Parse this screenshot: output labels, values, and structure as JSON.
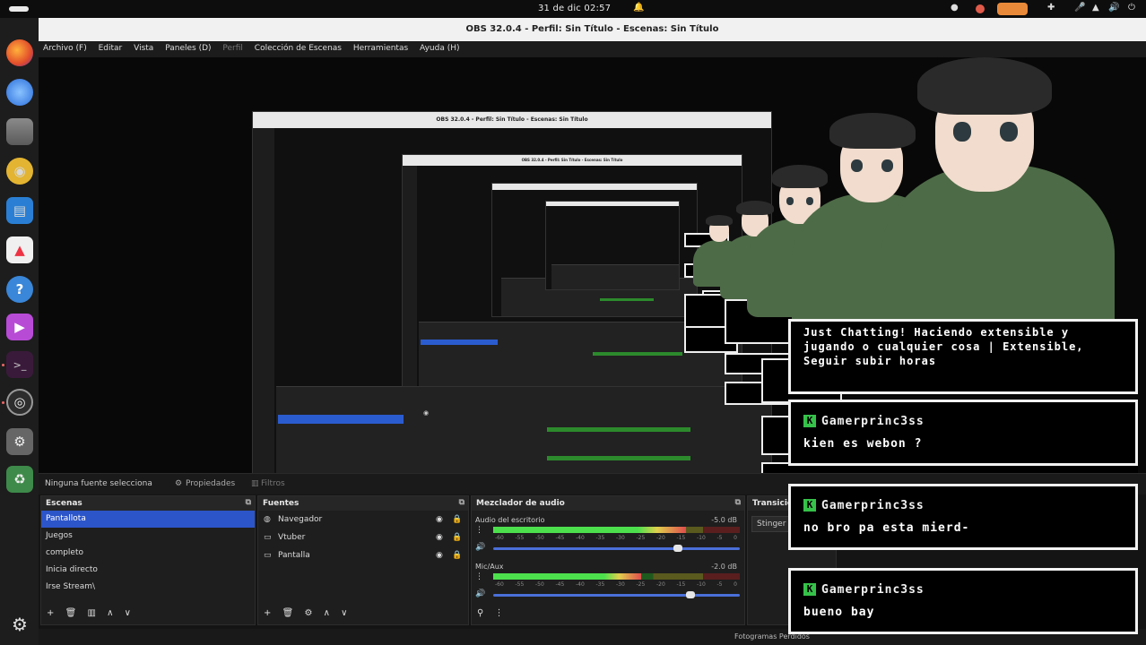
{
  "topbar": {
    "clock": "31 de dic  02:57",
    "bell_icon": "bell-icon",
    "tray_icons": [
      "record-indicator-icon",
      "screen-share-icon",
      "extensions-icon",
      "mic-icon",
      "wifi-icon",
      "volume-icon",
      "power-icon"
    ]
  },
  "dock": {
    "apps": [
      "firefox-icon",
      "thunderbird-icon",
      "files-icon",
      "rhythmbox-icon",
      "writer-icon",
      "app-center-icon",
      "help-icon",
      "video-icon",
      "terminal-icon",
      "obs-icon",
      "settings-icon",
      "trash-icon",
      "show-apps-icon"
    ]
  },
  "obs": {
    "title": "OBS 32.0.4 - Perfil: Sin Título - Escenas: Sin Título",
    "menu": [
      "Archivo (F)",
      "Editar",
      "Vista",
      "Paneles (D)",
      "Perfil",
      "Colección de Escenas",
      "Herramientas",
      "Ayuda (H)"
    ],
    "source_bar": {
      "selected_source": "Ninguna fuente selecciona",
      "properties": "Propiedades",
      "filters": "Filtros"
    },
    "scenes": {
      "title": "Escenas",
      "items": [
        "Pantallota",
        "Juegos",
        "completo",
        "Inicia directo",
        "Irse Stream\\"
      ]
    },
    "sources": {
      "title": "Fuentes",
      "items": [
        {
          "label": "Navegador",
          "icon": "globe-icon"
        },
        {
          "label": "Vtuber",
          "icon": "window-icon"
        },
        {
          "label": "Pantalla",
          "icon": "monitor-icon"
        }
      ]
    },
    "mixer": {
      "title": "Mezclador de audio",
      "ticks": [
        "-60",
        "-55",
        "-50",
        "-45",
        "-40",
        "-35",
        "-30",
        "-25",
        "-20",
        "-15",
        "-10",
        "-5",
        "0"
      ],
      "channels": [
        {
          "label": "Audio del escritorio",
          "db": "-5.0 dB",
          "level": 0.78,
          "volume": 0.75
        },
        {
          "label": "Mic/Aux",
          "db": "-2.0 dB",
          "level": 0.6,
          "volume": 0.8
        }
      ]
    },
    "transitions": {
      "title": "Transicion",
      "value": "Stinger"
    },
    "status": "Fotogramas Perdidos"
  },
  "chat": {
    "header_message": "Just Chatting! Haciendo extensible y jugando o cualquier cosa | Extensible, Seguir subir horas",
    "messages": [
      {
        "user": "Gamerprinc3ss",
        "text": "kien es webon ?"
      },
      {
        "user": "Gamerprinc3ss",
        "text": "no bro pa esta mierd-"
      },
      {
        "user": "Gamerprinc3ss",
        "text": "bueno bay"
      }
    ]
  },
  "colors": {
    "accent": "#2c55c9",
    "hoodie": "#4d6b47",
    "kick_green": "#36c24a"
  }
}
